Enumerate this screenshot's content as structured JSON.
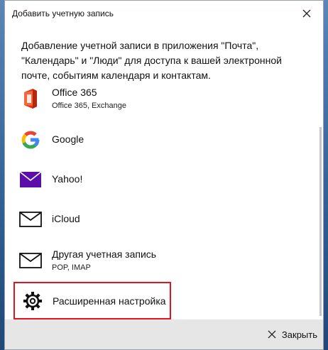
{
  "window": {
    "title": "Добавить учетную запись"
  },
  "intro_text": "Добавление учетной записи в приложения \"Почта\", \"Календарь\" и \"Люди\" для доступа к вашей электронной почте, событиям календаря и контактам.",
  "accounts": [
    {
      "label": "Office 365",
      "sub": "Office 365, Exchange",
      "icon": "office-icon"
    },
    {
      "label": "Google",
      "sub": "",
      "icon": "google-icon"
    },
    {
      "label": "Yahoo!",
      "sub": "",
      "icon": "yahoo-mail-icon"
    },
    {
      "label": "iCloud",
      "sub": "",
      "icon": "envelope-icon"
    },
    {
      "label": "Другая учетная запись",
      "sub": "POP, IMAP",
      "icon": "envelope-icon"
    },
    {
      "label": "Расширенная настройка",
      "sub": "",
      "icon": "gear-icon"
    }
  ],
  "footer": {
    "close_label": "Закрыть"
  },
  "colors": {
    "highlight_border": "#e0151f",
    "yahoo_purple": "#5b0fa8",
    "office_red": "#e4331b"
  }
}
